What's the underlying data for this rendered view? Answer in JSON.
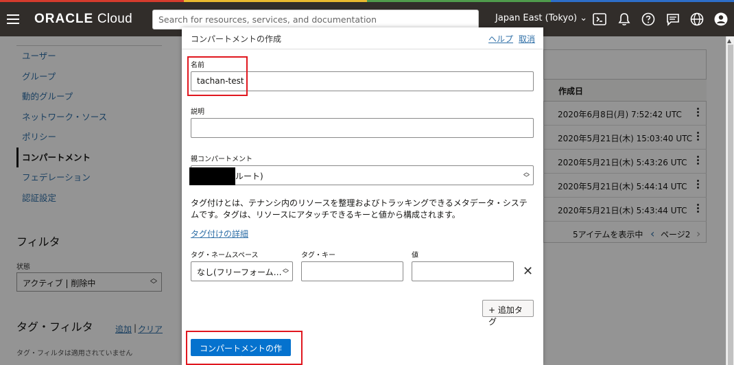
{
  "colors": {
    "header_bg": "#312d2a",
    "accent": "#0572ce",
    "link": "#2f6fa7",
    "highlight": "#e0161e",
    "strip": [
      "#d43b2d",
      "#e8b92f",
      "#4f9b4c",
      "#2d6ec9"
    ]
  },
  "header": {
    "logo_brand": "ORACLE",
    "logo_product": "Cloud",
    "search_placeholder": "Search for resources, services, and documentation",
    "region": "Japan East (Tokyo)",
    "icons": [
      "menu-icon",
      "cloud-shell-icon",
      "bell-icon",
      "help-icon",
      "chat-icon",
      "globe-icon",
      "profile-icon"
    ]
  },
  "sidebar": {
    "items": [
      {
        "label": "ユーザー"
      },
      {
        "label": "グループ"
      },
      {
        "label": "動的グループ"
      },
      {
        "label": "ネットワーク・ソース"
      },
      {
        "label": "ポリシー"
      },
      {
        "label": "コンパートメント",
        "active": true
      },
      {
        "label": "フェデレーション"
      },
      {
        "label": "認証設定"
      }
    ],
    "filter_title": "フィルタ",
    "state_label": "状態",
    "state_value": "アクティブ | 削除中",
    "tag_filter_title": "タグ・フィルタ",
    "tag_add": "追加",
    "tag_separator": "|",
    "tag_clear": "クリア",
    "tag_filter_note": "タグ・フィルタは適用されていません"
  },
  "table": {
    "column_header": "作成日",
    "rows": [
      {
        "created": "2020年6月8日(月) 7:52:42 UTC"
      },
      {
        "created": "2020年5月21日(木) 15:03:40 UTC"
      },
      {
        "created": "2020年5月21日(木) 5:43:26 UTC"
      },
      {
        "created": "2020年5月21日(木) 5:44:14 UTC"
      },
      {
        "created": "2020年5月21日(木) 5:43:44 UTC"
      }
    ],
    "pager_count": "5アイテムを表示中",
    "pager_page": "ページ2"
  },
  "modal": {
    "title": "コンパートメントの作成",
    "help": "ヘルプ",
    "cancel": "取消",
    "name_label": "名前",
    "name_value": "tachan-test",
    "description_label": "説明",
    "description_value": "",
    "parent_label": "親コンパートメント",
    "parent_value": "ルート)",
    "tag_description": "タグ付けとは、テナンシ内のリソースを整理およびトラッキングできるメタデータ・システムです。タグは、リソースにアタッチできるキーと値から構成されます。",
    "tag_link": "タグ付けの詳細",
    "tag_namespace_label": "タグ・ネームスペース",
    "tag_namespace_value": "なし(フリーフォーム…",
    "tag_key_label": "タグ・キー",
    "tag_key_value": "",
    "tag_value_label": "値",
    "tag_value_value": "",
    "add_tag_button": "+ 追加タグ",
    "create_button": "コンパートメントの作成"
  }
}
